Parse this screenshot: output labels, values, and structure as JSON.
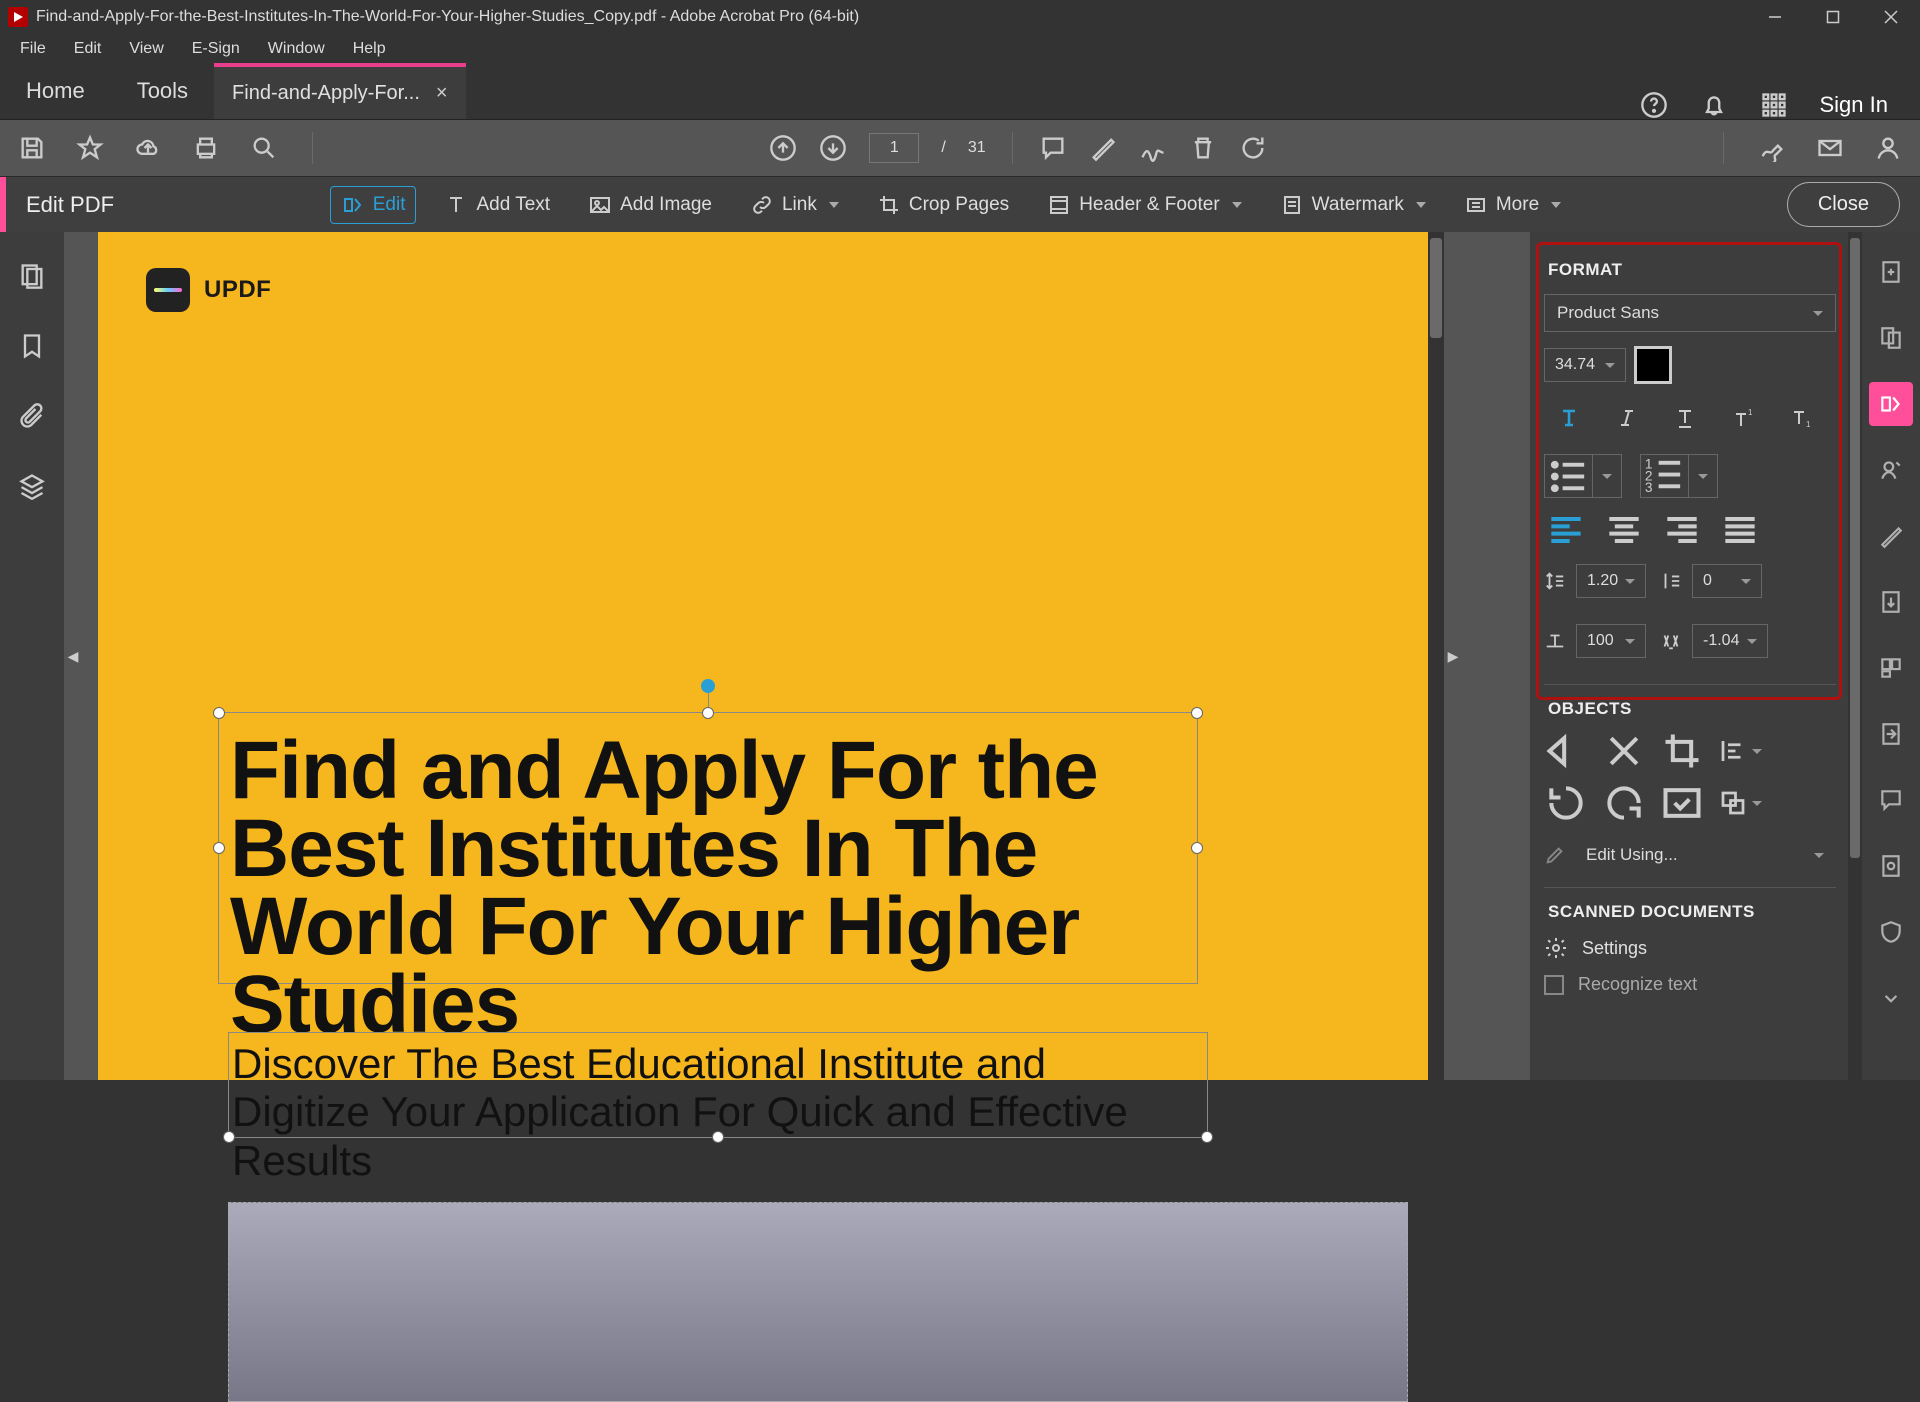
{
  "window": {
    "title": "Find-and-Apply-For-the-Best-Institutes-In-The-World-For-Your-Higher-Studies_Copy.pdf - Adobe Acrobat Pro (64-bit)"
  },
  "menu": {
    "file": "File",
    "edit": "Edit",
    "view": "View",
    "esign": "E-Sign",
    "window": "Window",
    "help": "Help"
  },
  "tabs": {
    "home": "Home",
    "tools": "Tools",
    "doc": "Find-and-Apply-For..."
  },
  "signin": "Sign In",
  "page": {
    "current": "1",
    "sep": "/",
    "total": "31"
  },
  "editpdf": {
    "title": "Edit PDF",
    "edit": "Edit",
    "addtext": "Add Text",
    "addimage": "Add Image",
    "link": "Link",
    "croppages": "Crop Pages",
    "headerfooter": "Header & Footer",
    "watermark": "Watermark",
    "more": "More",
    "close": "Close"
  },
  "doc": {
    "brand": "UPDF",
    "headline": "Find and Apply For the Best Institutes In The World For Your Higher Studies",
    "subtitle": "Discover The Best Educational Institute and Digitize Your Application For Quick and Effective Results"
  },
  "format": {
    "heading": "FORMAT",
    "font": "Product Sans",
    "size": "34.74",
    "lineheight": "1.20",
    "paraspace": "0",
    "hscale": "100",
    "charspace": "-1.04"
  },
  "objects": {
    "heading": "OBJECTS",
    "editusing": "Edit Using..."
  },
  "scanned": {
    "heading": "SCANNED DOCUMENTS",
    "settings": "Settings",
    "recognize": "Recognize text"
  }
}
